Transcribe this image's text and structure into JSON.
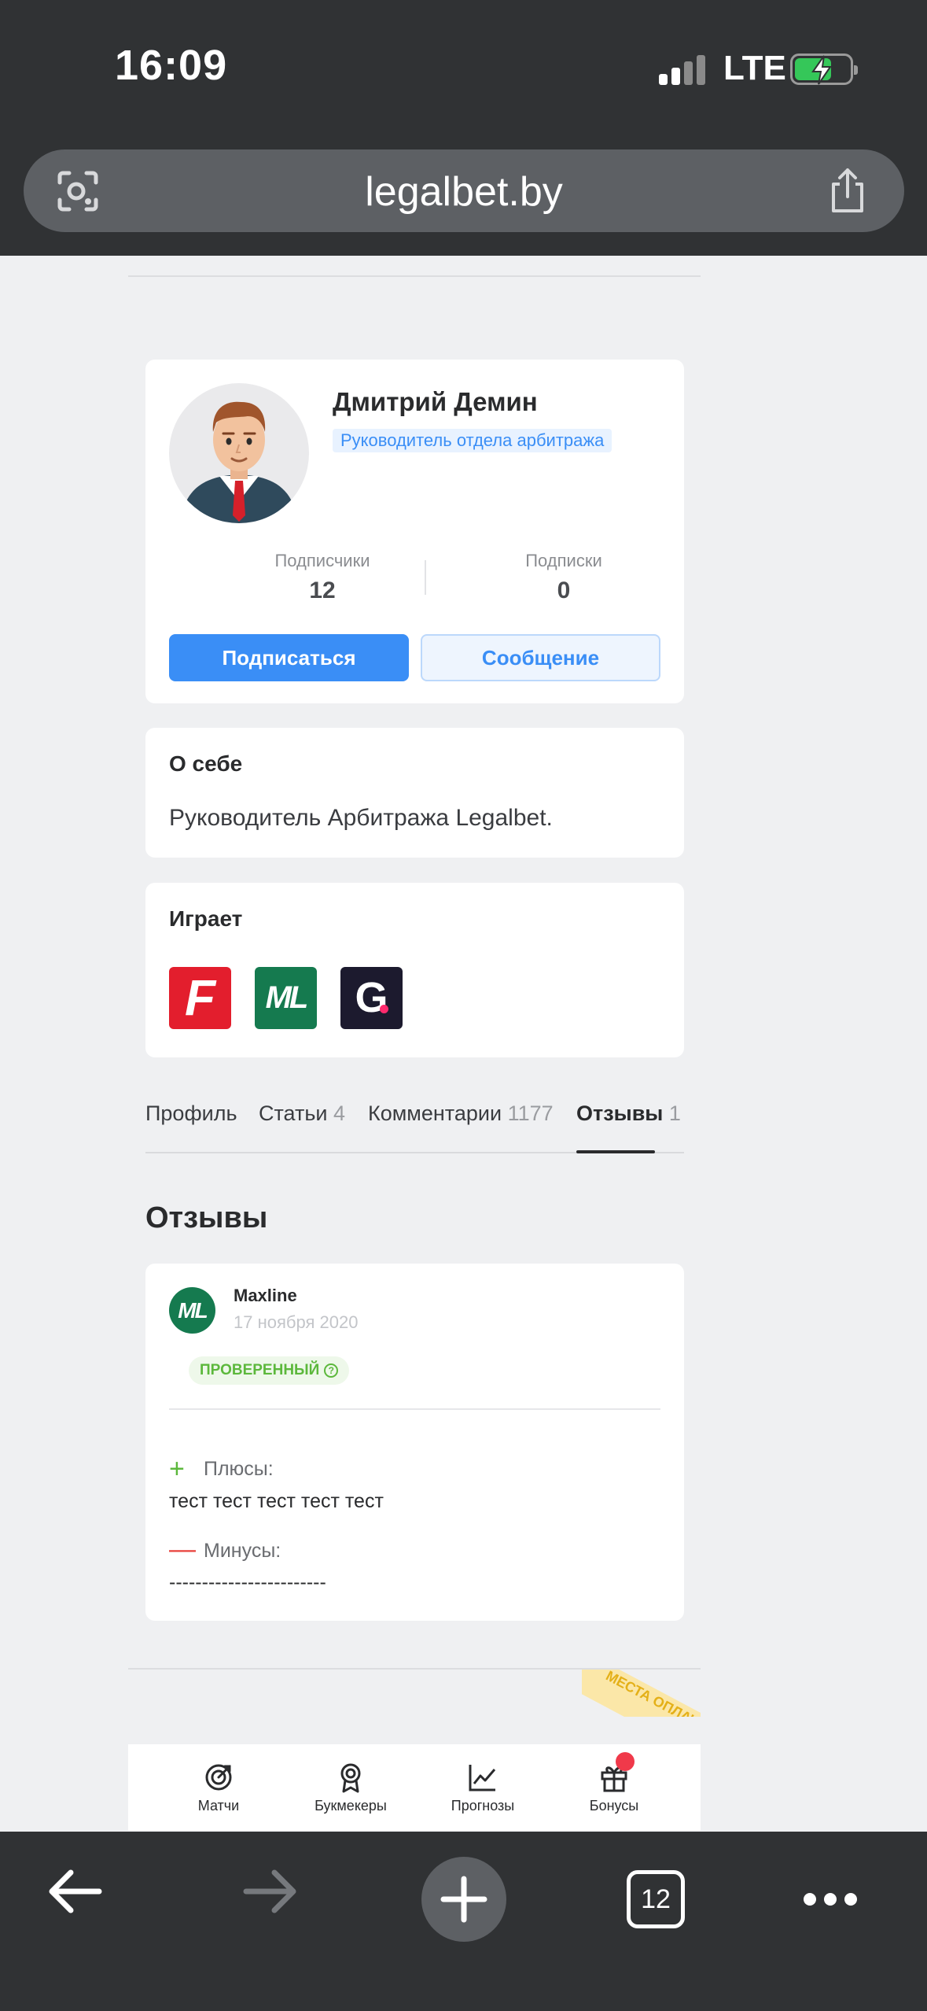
{
  "status_bar": {
    "time": "16:09",
    "network": "LTE"
  },
  "browser": {
    "url": "legalbet.by",
    "tab_count": "12"
  },
  "profile": {
    "name": "Дмитрий Демин",
    "role": "Руководитель отдела арбитража",
    "followers_label": "Подписчики",
    "followers_value": "12",
    "following_label": "Подписки",
    "following_value": "0",
    "subscribe_label": "Подписаться",
    "message_label": "Сообщение"
  },
  "about": {
    "title": "О себе",
    "text": "Руководитель Арбитража Legalbet."
  },
  "plays": {
    "title": "Играет",
    "logos": [
      {
        "icon": "fonbet-logo",
        "text": "F"
      },
      {
        "icon": "maxline-logo",
        "text": "ML"
      },
      {
        "icon": "gg-logo",
        "text": "G"
      }
    ]
  },
  "tabs": [
    {
      "label": "Профиль",
      "count": ""
    },
    {
      "label": "Статьи",
      "count": "4"
    },
    {
      "label": "Комментарии",
      "count": "1177"
    },
    {
      "label": "Отзывы",
      "count": "1",
      "active": true
    }
  ],
  "reviews": {
    "heading": "Отзывы",
    "items": [
      {
        "logo_text": "ML",
        "bookmaker": "Maxline",
        "date": "17 ноября 2020",
        "badge": "ПРОВЕРЕННЫЙ",
        "pros_label": "Плюсы:",
        "pros_text": "тест тест тест тест тест",
        "cons_label": "Минусы:",
        "cons_text": "------------------------"
      }
    ]
  },
  "promo": {
    "text": "МЕСТА ОПЛАЧЕН"
  },
  "site_nav": [
    {
      "label": "Матчи",
      "icon": "target-icon"
    },
    {
      "label": "Букмекеры",
      "icon": "award-icon"
    },
    {
      "label": "Прогнозы",
      "icon": "chart-icon"
    },
    {
      "label": "Бонусы",
      "icon": "gift-icon"
    }
  ],
  "colors": {
    "accent": "#3a8ef6",
    "verified": "#5cb83c",
    "cons": "#e8413b",
    "chrome": "#303234"
  }
}
